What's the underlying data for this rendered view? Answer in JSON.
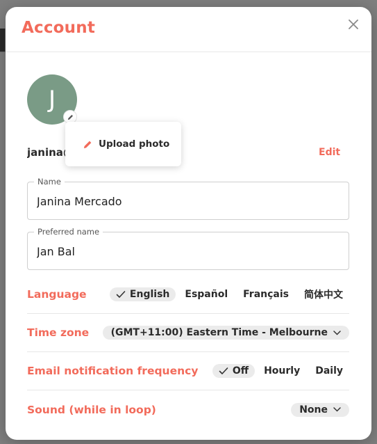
{
  "modal": {
    "title": "Account"
  },
  "profile": {
    "avatar_initial": "J",
    "email": "janina@",
    "edit_label": "Edit",
    "upload_photo_label": "Upload photo"
  },
  "fields": {
    "name": {
      "label": "Name",
      "value": "Janina Mercado"
    },
    "preferred_name": {
      "label": "Preferred name",
      "value": "Jan Bal"
    }
  },
  "settings": {
    "language": {
      "label": "Language",
      "options": [
        "English",
        "Español",
        "Français",
        "简体中文"
      ],
      "selected": "English"
    },
    "time_zone": {
      "label": "Time zone",
      "value": "(GMT+11:00) Eastern Time - Melbourne"
    },
    "email_notification": {
      "label": "Email notification frequency",
      "options": [
        "Off",
        "Hourly",
        "Daily"
      ],
      "selected": "Off"
    },
    "sound": {
      "label": "Sound (while in loop)",
      "value": "None"
    }
  },
  "colors": {
    "accent": "#f26b5b",
    "avatar_bg": "#7a9b86",
    "selected_pill": "#ebebeb"
  },
  "icons": {
    "close": "close-icon",
    "pencil": "pencil-icon",
    "check": "check-icon",
    "chevron": "chevron-down-icon"
  }
}
